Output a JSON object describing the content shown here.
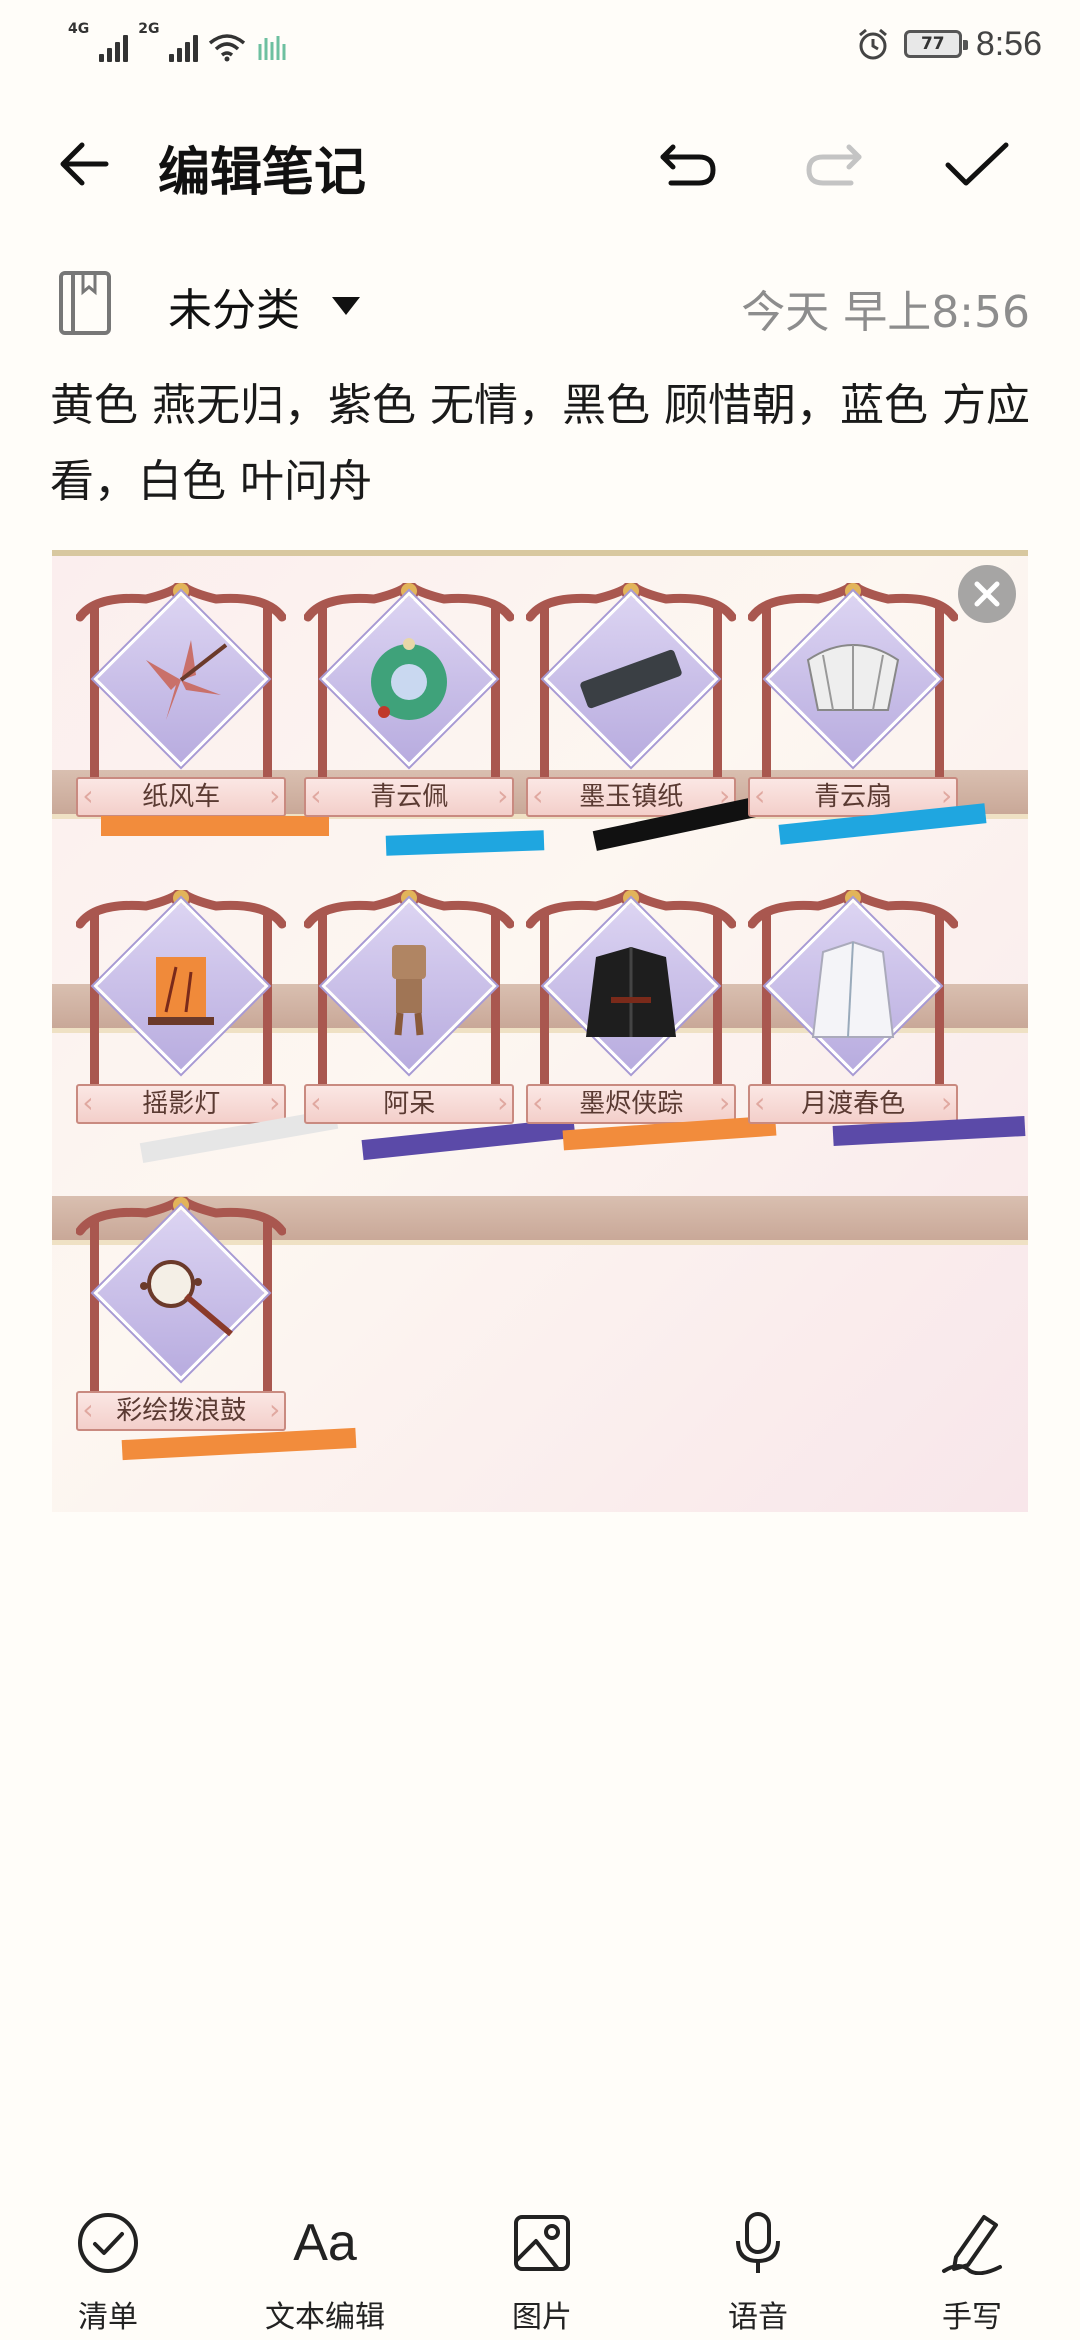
{
  "status_bar": {
    "net1": "4G",
    "net2": "2G",
    "battery": "77",
    "time": "8:56"
  },
  "toolbar": {
    "title": "编辑笔记"
  },
  "meta": {
    "category": "未分类",
    "timestamp": "今天 早上8:56"
  },
  "note": {
    "text": "黄色 燕无归，紫色 无情，黑色 顾惜朝，蓝色 方应看，白色 叶问舟"
  },
  "image": {
    "items": [
      {
        "label": "纸风车",
        "stripe_color": "#f28c3c"
      },
      {
        "label": "青云佩",
        "stripe_color": "#1fa6e0"
      },
      {
        "label": "墨玉镇纸",
        "stripe_color": "#111111"
      },
      {
        "label": "青云扇",
        "stripe_color": "#1fa6e0"
      },
      {
        "label": "摇影灯",
        "stripe_color": "#e6e6e6"
      },
      {
        "label": "阿呆",
        "stripe_color": "#5b4aa8"
      },
      {
        "label": "墨烬侠踪",
        "stripe_color": "#f28c3c"
      },
      {
        "label": "月渡春色",
        "stripe_color": "#5b4aa8"
      },
      {
        "label": "彩绘拨浪鼓",
        "stripe_color": "#f28c3c"
      }
    ]
  },
  "bottom_bar": {
    "items": [
      {
        "label": "清单",
        "icon": "checklist-icon"
      },
      {
        "label": "文本编辑",
        "icon": "text-format-icon"
      },
      {
        "label": "图片",
        "icon": "image-icon"
      },
      {
        "label": "语音",
        "icon": "microphone-icon"
      },
      {
        "label": "手写",
        "icon": "handwriting-icon"
      }
    ],
    "aa_glyph": "Aa"
  }
}
